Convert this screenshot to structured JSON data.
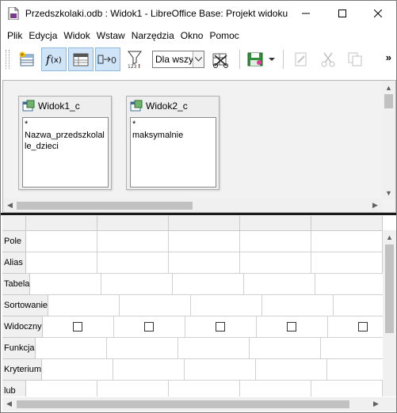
{
  "window": {
    "title": "Przedszkolaki.odb : Widok1 - LibreOffice Base: Projekt widoku"
  },
  "menu": [
    "Plik",
    "Edycja",
    "Widok",
    "Wstaw",
    "Narzędzia",
    "Okno",
    "Pomoc"
  ],
  "toolbar": {
    "limit_select_value": "Dla wszy",
    "icons": [
      "add-table-icon",
      "functions-icon",
      "table-names-icon",
      "aliases-icon",
      "distinct-values-icon",
      "limit-select",
      "clear-query-icon",
      "save-icon",
      "save-dropdown-icon",
      "edit-icon",
      "cut-icon",
      "copy-icon",
      "more-icon"
    ],
    "more_label": "»"
  },
  "tables": [
    {
      "title": "Widok1_c",
      "fields": [
        "*",
        "Nazwa_przedszkolalle_dzieci"
      ]
    },
    {
      "title": "Widok2_c",
      "fields": [
        "*",
        "maksymalnie"
      ]
    }
  ],
  "grid": {
    "row_labels": [
      "Pole",
      "Alias",
      "Tabela",
      "Sortowanie",
      "Widoczny",
      "Funkcja",
      "Kryterium",
      "lub"
    ],
    "columns": 5,
    "visible_row": "Widoczny"
  }
}
